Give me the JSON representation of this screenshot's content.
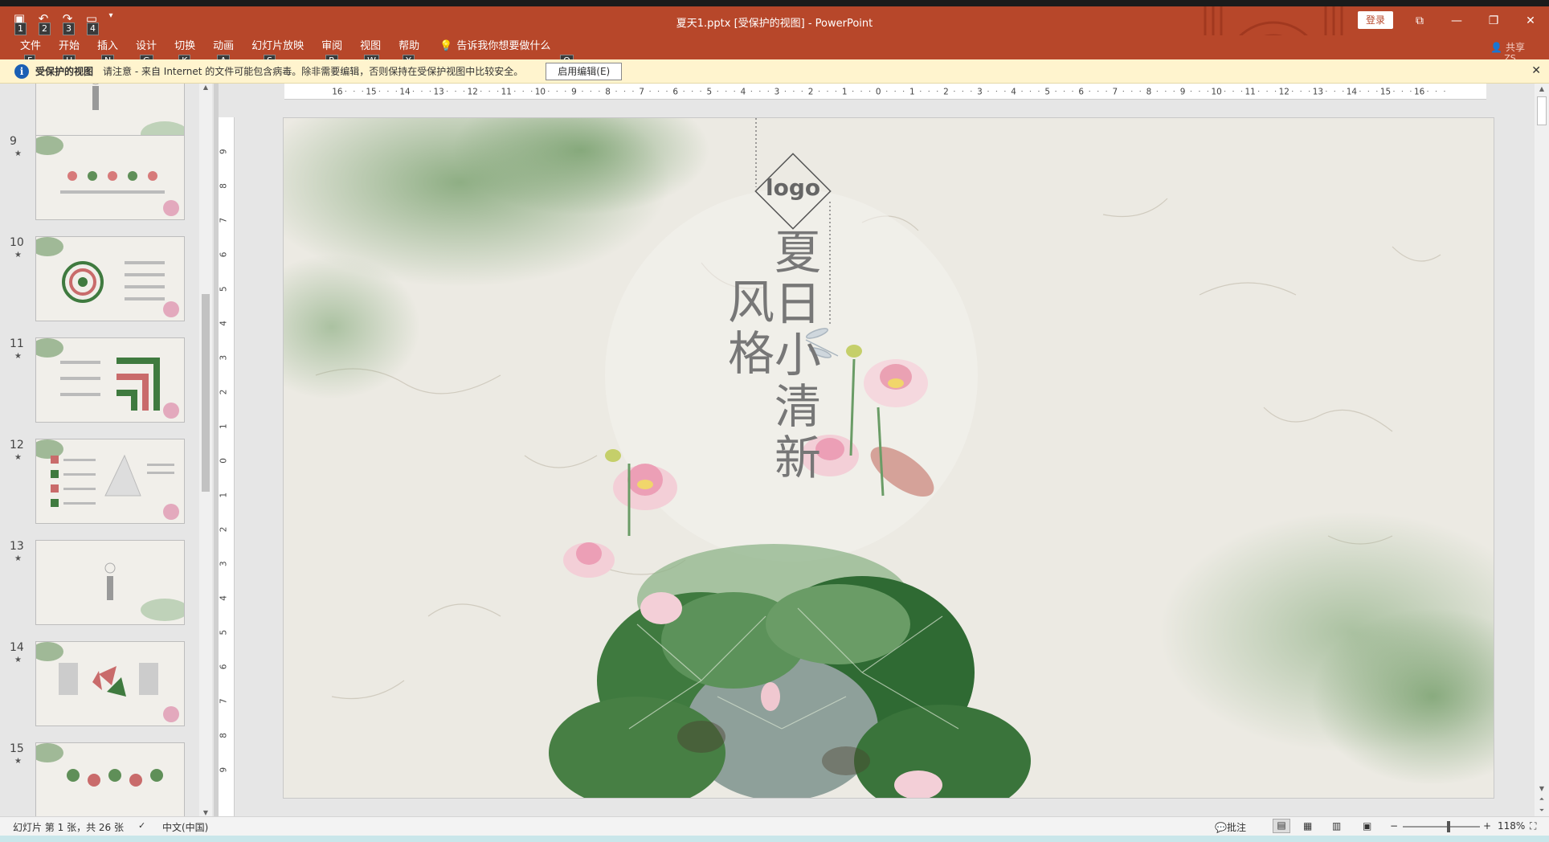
{
  "titlebar": {
    "doc_title": "夏天1.pptx [受保护的视图]  -  PowerPoint",
    "login": "登录",
    "qat_keytips": [
      "1",
      "2",
      "3",
      "4"
    ],
    "win_restore": "⧉",
    "win_min": "—",
    "win_max": "❐",
    "win_close": "✕"
  },
  "ribbon": {
    "tabs": [
      {
        "label": "文件",
        "key": "F"
      },
      {
        "label": "开始",
        "key": "H"
      },
      {
        "label": "插入",
        "key": "N"
      },
      {
        "label": "设计",
        "key": "G"
      },
      {
        "label": "切换",
        "key": "K"
      },
      {
        "label": "动画",
        "key": "A"
      },
      {
        "label": "幻灯片放映",
        "key": "S"
      },
      {
        "label": "审阅",
        "key": "R"
      },
      {
        "label": "视图",
        "key": "W"
      },
      {
        "label": "帮助",
        "key": "Y"
      }
    ],
    "tellme": "告诉我你想要做什么",
    "tellme_key": "Q",
    "share": "共享",
    "share_key": "ZS"
  },
  "protected_bar": {
    "title": "受保护的视图",
    "message": "请注意 - 来自 Internet 的文件可能包含病毒。除非需要编辑，否则保持在受保护视图中比较安全。",
    "enable_button": "启用编辑(E)",
    "close": "✕"
  },
  "thumbnails": {
    "slides": [
      {
        "num": "",
        "star": "★"
      },
      {
        "num": "9",
        "star": "★"
      },
      {
        "num": "10",
        "star": "★"
      },
      {
        "num": "11",
        "star": "★"
      },
      {
        "num": "12",
        "star": "★"
      },
      {
        "num": "13",
        "star": "★"
      },
      {
        "num": "14",
        "star": "★"
      },
      {
        "num": "15",
        "star": "★"
      }
    ]
  },
  "ruler": {
    "h_ticks": [
      "16",
      "15",
      "14",
      "13",
      "12",
      "11",
      "10",
      "9",
      "8",
      "7",
      "6",
      "5",
      "4",
      "3",
      "2",
      "1",
      "0",
      "1",
      "2",
      "3",
      "4",
      "5",
      "6",
      "7",
      "8",
      "9",
      "10",
      "11",
      "12",
      "13",
      "14",
      "15",
      "16"
    ],
    "v_ticks": [
      "9",
      "8",
      "7",
      "6",
      "5",
      "4",
      "3",
      "2",
      "1",
      "0",
      "1",
      "2",
      "3",
      "4",
      "5",
      "6",
      "7",
      "8",
      "9"
    ]
  },
  "slide": {
    "logo": "logo",
    "title_main": "夏日小清新",
    "title_sub": "风格"
  },
  "status": {
    "slide_info": "幻灯片 第 1 张，共 26 张",
    "language": "中文(中国)",
    "comments": "批注",
    "zoom": "118%",
    "zoom_fraction": 0.59
  },
  "colors": {
    "accent": "#b7472a",
    "message_bar": "#fff4ce"
  }
}
